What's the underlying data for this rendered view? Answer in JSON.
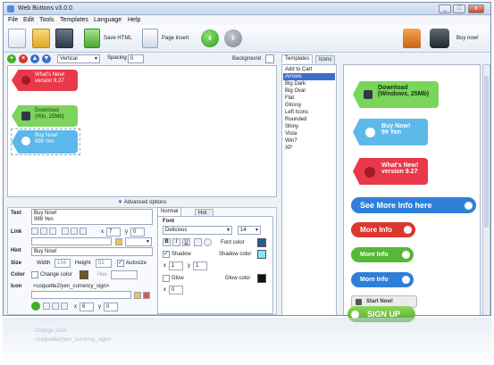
{
  "window": {
    "title": "Web Buttons v3.0.0",
    "minimize": "_",
    "maximize": "□",
    "close": "x"
  },
  "menu": [
    "File",
    "Edit",
    "Tools",
    "Templates",
    "Language",
    "Help"
  ],
  "toolbar": {
    "save_html": "Save HTML",
    "page_insert": "Page insert",
    "buy_now": "Buy now!"
  },
  "controls": {
    "orientation": "Vertical",
    "spacing_label": "Spacing",
    "spacing_value": "0",
    "background_label": "Background"
  },
  "canvas_buttons": [
    {
      "line1": "What's New!",
      "line2": "version 9.27",
      "color": "#e8394a",
      "text_color": "#ffffff"
    },
    {
      "line1": "Download",
      "line2": "(Win, 25Mb)",
      "color": "#7bd45c",
      "text_color": "#1d3a12"
    },
    {
      "line1": "Buy Now!",
      "line2": "999 Yen",
      "color": "#5ab8ea",
      "text_color": "#ffffff"
    }
  ],
  "advanced": {
    "label": "Advanced options"
  },
  "properties": {
    "text_label": "Text",
    "text_value_1": "Buy Now!",
    "text_value_2": "999 Yen",
    "link_label": "Link",
    "x_label": "x",
    "x_value": "7",
    "y_label": "y",
    "y_value": "0",
    "hint_label": "Hint",
    "hint_value": "Buy Now!",
    "size_label": "Size",
    "width_label": "Width",
    "width_value": "134",
    "height_label": "Height",
    "height_value": "52",
    "autosize_label": "Autosize",
    "color_label": "Color",
    "change_color_label": "Change color",
    "hex_label": "Hex",
    "icon_label": "Icon",
    "icon_value": "<coquette2/yen_currency_sign>",
    "icon_x_value": "6",
    "icon_y_value": "0"
  },
  "state_tabs": {
    "normal": "Normal state",
    "hot": "Hot state"
  },
  "font_panel": {
    "font_label": "Font",
    "font_name": "Delicious",
    "font_size": "14",
    "font_color_label": "Font color",
    "shadow_label": "Shadow",
    "shadow_color_label": "Shadow color",
    "shadow_x": "1",
    "shadow_y": "1",
    "glow_label": "Glow",
    "glow_color_label": "Glow color",
    "glow_x": "0",
    "bold": "B",
    "italic": "I",
    "underline": "U",
    "font_color": "#2a5d8c",
    "shadow_color": "#7ee9f4",
    "glow_color": "#111111"
  },
  "right_tabs": {
    "templates": "Templates",
    "icons": "Icons"
  },
  "templates": [
    "Add to Cart",
    "Arrows",
    "Big Dark",
    "Big Oval",
    "Flat",
    "Glossy",
    "Left Icons",
    "Rounded",
    "Shiny",
    "Vista",
    "Win7",
    "XP"
  ],
  "selected_template": "Arrows",
  "preview_buttons": [
    {
      "line1": "Download",
      "line2": "(Windows, 25Mb)",
      "color": "#79d65a"
    },
    {
      "line1": "Buy Now!",
      "line2": "99 Yen",
      "color": "#5db9ea"
    },
    {
      "line1": "What's New!",
      "line2": "version 9.27",
      "color": "#e8384a"
    },
    {
      "label": "See More Info here",
      "color": "#2f7fd8"
    },
    {
      "label": "More Info",
      "color": "#d9372f"
    },
    {
      "label": "More Info",
      "color": "#55b836"
    },
    {
      "label": "More Info",
      "color": "#2f7fd8"
    },
    {
      "label": "Start Now!",
      "color": "#e8e8e8"
    },
    {
      "label": "SIGN UP",
      "color": "#6cc13b"
    }
  ],
  "reflection": {
    "line1": "<coquette2/yen_currency_sign>",
    "line2": "Change color"
  }
}
